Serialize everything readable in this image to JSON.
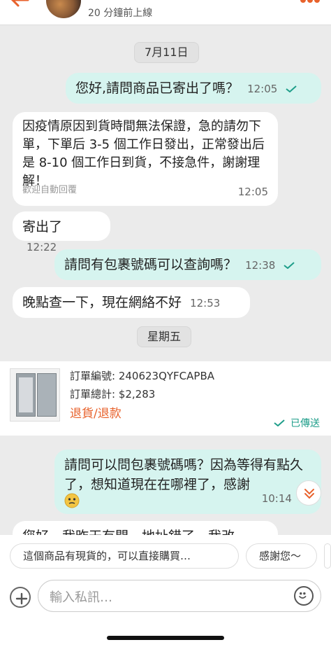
{
  "header": {
    "status": "20 分鐘前上線"
  },
  "chat": {
    "date1": "7月11日",
    "m1": {
      "text": "您好,請問商品已寄出了嗎？",
      "time": "12:05"
    },
    "m2": {
      "text": "因疫情原因到貨時間無法保證，急的請勿下單，下單后 3-5 個工作日發出，正常發出后是 8-10 個工作日到貨，不接急件，謝謝理解！",
      "sub": "歡迎自動回覆",
      "time": "12:05"
    },
    "m3": {
      "text": "寄出了",
      "time": "12:22"
    },
    "m4": {
      "text": "請問有包裹號碼可以查詢嗎？",
      "time": "12:38"
    },
    "m5": {
      "text": "晚點查一下，現在網絡不好",
      "time": "12:53"
    },
    "date2": "星期五",
    "order": {
      "no": "訂單編號: 240623QYFCAPBA",
      "total": "訂單總計: $2,283",
      "action": "退貨/退款",
      "status": "已傳送"
    },
    "m6": {
      "text": "請問可以問包裹號碼嗎？因為等得有點久了，想知道現在在哪裡了，感謝",
      "time": "10:14"
    },
    "m7": {
      "text": "您好，我昨天有問，地址錯了，我改"
    }
  },
  "quick_replies": [
    "這個商品有現貨的，可以直接購買…",
    "感謝您～"
  ],
  "input": {
    "placeholder": "輸入私訊…"
  },
  "colors": {
    "accent": "#e8622c",
    "outgoing": "#d6f4ef",
    "check": "#1f9e8a"
  }
}
